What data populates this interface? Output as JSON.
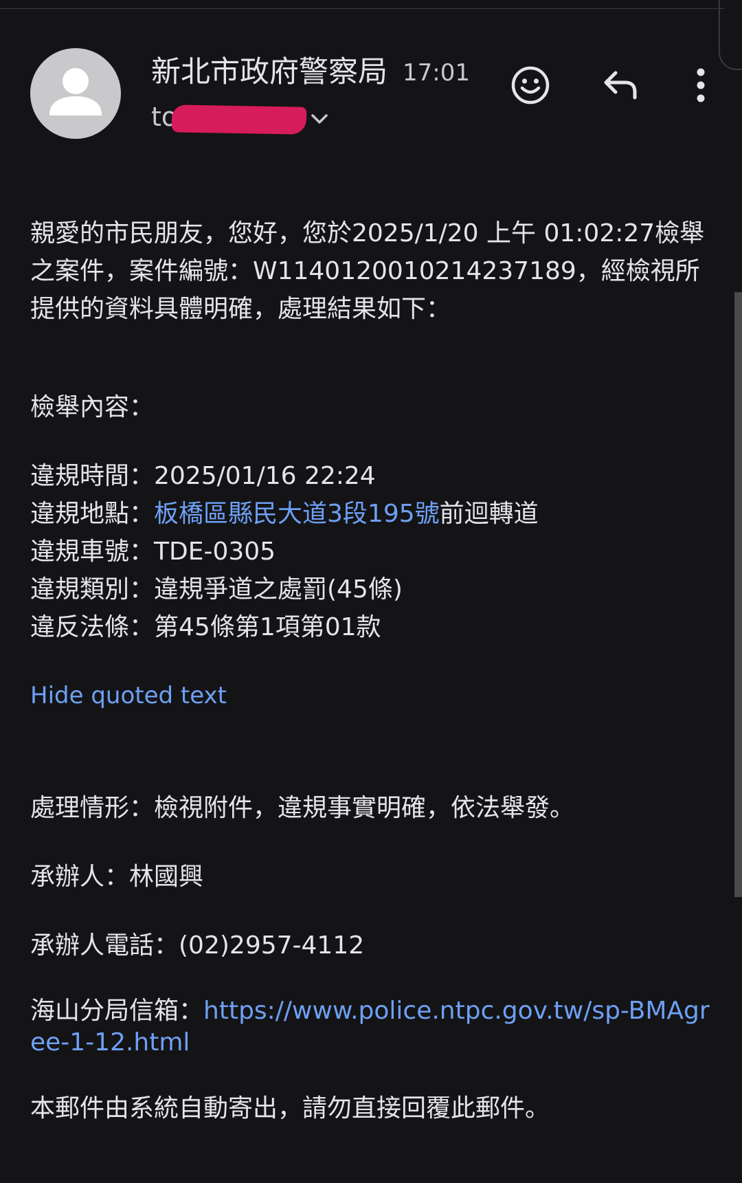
{
  "header": {
    "sender_name": "新北市政府警察局",
    "time": "17:01",
    "to_prefix": "to",
    "recipient_redacted": "",
    "avatar_icon": "person-icon",
    "actions": {
      "emoji_icon": "smiley-icon",
      "reply_icon": "reply-icon",
      "more_icon": "more-vertical-icon"
    }
  },
  "body": {
    "intro": "親愛的市民朋友，您好，您於2025/1/20 上午 01:02:27檢舉之案件，案件編號：W1140120010214237189，經檢視所提供的資料具體明確，處理結果如下：",
    "section_title": "檢舉內容：",
    "violation_time_label": "違規時間：",
    "violation_time_value": "2025/01/16 22:24",
    "violation_place_label": "違規地點：",
    "violation_place_link": "板橋區縣民大道3段195號",
    "violation_place_suffix": "前迴轉道",
    "violation_plate_label": "違規車號：",
    "violation_plate_value": "TDE-0305",
    "violation_type_label": "違規類別：",
    "violation_type_value": "違規爭道之處罰(45條)",
    "violation_law_label": "違反法條：",
    "violation_law_value": "第45條第1項第01款",
    "hide_quoted": "Hide quoted text",
    "result_label": "處理情形：",
    "result_value": "檢視附件，違規事實明確，依法舉發。",
    "handler_label": "承辦人：",
    "handler_value": "林國興",
    "phone_label": "承辦人電話：",
    "phone_value": "(02)2957-4112",
    "mailbox_label": "海山分局信箱：",
    "mailbox_link": "https://www.police.ntpc.gov.tw/sp-BMAgree-1-12.html",
    "footer_note": "本郵件由系統自動寄出，請勿直接回覆此郵件。"
  },
  "colors": {
    "background": "#141416",
    "text": "#e6e4ea",
    "link": "#6ea0f5",
    "redaction": "#d61c5a"
  }
}
